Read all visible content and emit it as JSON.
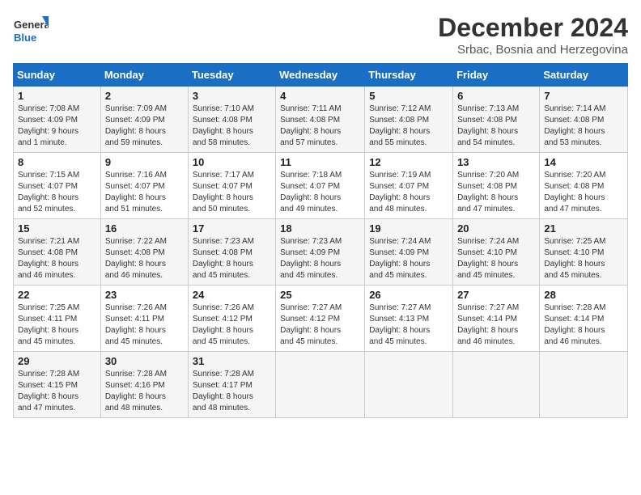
{
  "logo": {
    "line1": "General",
    "line2": "Blue"
  },
  "title": "December 2024",
  "subtitle": "Srbac, Bosnia and Herzegovina",
  "days_header": [
    "Sunday",
    "Monday",
    "Tuesday",
    "Wednesday",
    "Thursday",
    "Friday",
    "Saturday"
  ],
  "weeks": [
    [
      {
        "num": "1",
        "info": "Sunrise: 7:08 AM\nSunset: 4:09 PM\nDaylight: 9 hours\nand 1 minute."
      },
      {
        "num": "2",
        "info": "Sunrise: 7:09 AM\nSunset: 4:09 PM\nDaylight: 8 hours\nand 59 minutes."
      },
      {
        "num": "3",
        "info": "Sunrise: 7:10 AM\nSunset: 4:08 PM\nDaylight: 8 hours\nand 58 minutes."
      },
      {
        "num": "4",
        "info": "Sunrise: 7:11 AM\nSunset: 4:08 PM\nDaylight: 8 hours\nand 57 minutes."
      },
      {
        "num": "5",
        "info": "Sunrise: 7:12 AM\nSunset: 4:08 PM\nDaylight: 8 hours\nand 55 minutes."
      },
      {
        "num": "6",
        "info": "Sunrise: 7:13 AM\nSunset: 4:08 PM\nDaylight: 8 hours\nand 54 minutes."
      },
      {
        "num": "7",
        "info": "Sunrise: 7:14 AM\nSunset: 4:08 PM\nDaylight: 8 hours\nand 53 minutes."
      }
    ],
    [
      {
        "num": "8",
        "info": "Sunrise: 7:15 AM\nSunset: 4:07 PM\nDaylight: 8 hours\nand 52 minutes."
      },
      {
        "num": "9",
        "info": "Sunrise: 7:16 AM\nSunset: 4:07 PM\nDaylight: 8 hours\nand 51 minutes."
      },
      {
        "num": "10",
        "info": "Sunrise: 7:17 AM\nSunset: 4:07 PM\nDaylight: 8 hours\nand 50 minutes."
      },
      {
        "num": "11",
        "info": "Sunrise: 7:18 AM\nSunset: 4:07 PM\nDaylight: 8 hours\nand 49 minutes."
      },
      {
        "num": "12",
        "info": "Sunrise: 7:19 AM\nSunset: 4:07 PM\nDaylight: 8 hours\nand 48 minutes."
      },
      {
        "num": "13",
        "info": "Sunrise: 7:20 AM\nSunset: 4:08 PM\nDaylight: 8 hours\nand 47 minutes."
      },
      {
        "num": "14",
        "info": "Sunrise: 7:20 AM\nSunset: 4:08 PM\nDaylight: 8 hours\nand 47 minutes."
      }
    ],
    [
      {
        "num": "15",
        "info": "Sunrise: 7:21 AM\nSunset: 4:08 PM\nDaylight: 8 hours\nand 46 minutes."
      },
      {
        "num": "16",
        "info": "Sunrise: 7:22 AM\nSunset: 4:08 PM\nDaylight: 8 hours\nand 46 minutes."
      },
      {
        "num": "17",
        "info": "Sunrise: 7:23 AM\nSunset: 4:08 PM\nDaylight: 8 hours\nand 45 minutes."
      },
      {
        "num": "18",
        "info": "Sunrise: 7:23 AM\nSunset: 4:09 PM\nDaylight: 8 hours\nand 45 minutes."
      },
      {
        "num": "19",
        "info": "Sunrise: 7:24 AM\nSunset: 4:09 PM\nDaylight: 8 hours\nand 45 minutes."
      },
      {
        "num": "20",
        "info": "Sunrise: 7:24 AM\nSunset: 4:10 PM\nDaylight: 8 hours\nand 45 minutes."
      },
      {
        "num": "21",
        "info": "Sunrise: 7:25 AM\nSunset: 4:10 PM\nDaylight: 8 hours\nand 45 minutes."
      }
    ],
    [
      {
        "num": "22",
        "info": "Sunrise: 7:25 AM\nSunset: 4:11 PM\nDaylight: 8 hours\nand 45 minutes."
      },
      {
        "num": "23",
        "info": "Sunrise: 7:26 AM\nSunset: 4:11 PM\nDaylight: 8 hours\nand 45 minutes."
      },
      {
        "num": "24",
        "info": "Sunrise: 7:26 AM\nSunset: 4:12 PM\nDaylight: 8 hours\nand 45 minutes."
      },
      {
        "num": "25",
        "info": "Sunrise: 7:27 AM\nSunset: 4:12 PM\nDaylight: 8 hours\nand 45 minutes."
      },
      {
        "num": "26",
        "info": "Sunrise: 7:27 AM\nSunset: 4:13 PM\nDaylight: 8 hours\nand 45 minutes."
      },
      {
        "num": "27",
        "info": "Sunrise: 7:27 AM\nSunset: 4:14 PM\nDaylight: 8 hours\nand 46 minutes."
      },
      {
        "num": "28",
        "info": "Sunrise: 7:28 AM\nSunset: 4:14 PM\nDaylight: 8 hours\nand 46 minutes."
      }
    ],
    [
      {
        "num": "29",
        "info": "Sunrise: 7:28 AM\nSunset: 4:15 PM\nDaylight: 8 hours\nand 47 minutes."
      },
      {
        "num": "30",
        "info": "Sunrise: 7:28 AM\nSunset: 4:16 PM\nDaylight: 8 hours\nand 48 minutes."
      },
      {
        "num": "31",
        "info": "Sunrise: 7:28 AM\nSunset: 4:17 PM\nDaylight: 8 hours\nand 48 minutes."
      },
      null,
      null,
      null,
      null
    ]
  ]
}
